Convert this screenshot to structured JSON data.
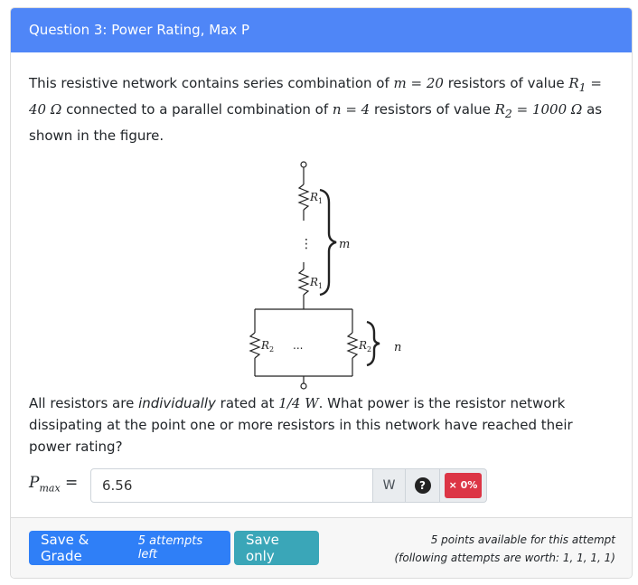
{
  "header": {
    "title": "Question 3: Power Rating, Max P"
  },
  "question": {
    "p1_a": "This resistive network contains series combination of ",
    "m_eq": "m = 20",
    "p1_b": " resistors of value ",
    "r1_eq": "R",
    "r1_sub": "1",
    "r1_val": " = 40 Ω",
    "p1_c": " connected to a parallel combination of ",
    "n_eq": "n = 4",
    "p1_d": " resistors of value ",
    "r2_eq": "R",
    "r2_sub": "2",
    "r2_val": " = 1000 Ω",
    "p1_e": " as shown in the figure.",
    "p2_a": "All resistors are ",
    "p2_em": "individually",
    "p2_b": " rated at ",
    "p2_rating": "1/4 W",
    "p2_c": ". What power is the resistor network dissipating at the point one or more resistors in this network have reached their power rating?"
  },
  "figure": {
    "r1_top_label": "R",
    "r1_top_sub": "1",
    "r1_bottom_label": "R",
    "r1_bottom_sub": "1",
    "m_label": "m",
    "vdots": "⋮",
    "r2_left_label": "R",
    "r2_left_sub": "2",
    "r2_right_label": "R",
    "r2_right_sub": "2",
    "hdots": "...",
    "n_label": "n"
  },
  "answer": {
    "label": "P",
    "label_sub": "max",
    "equals": " =",
    "value": "6.56",
    "unit": "W",
    "help_icon": "?",
    "score": "× 0%"
  },
  "footer": {
    "save_grade_label": "Save & Grade",
    "attempts_left": "5 attempts left",
    "save_only_label": "Save only",
    "points_note": "5 points available for this attempt",
    "following_note": "(following attempts are worth: 1, 1, 1, 1)"
  },
  "colors": {
    "header_bg": "#4f86f7",
    "primary_button": "#2f7ff7",
    "info_button": "#3aa6b8",
    "score_badge": "#dc3545"
  }
}
